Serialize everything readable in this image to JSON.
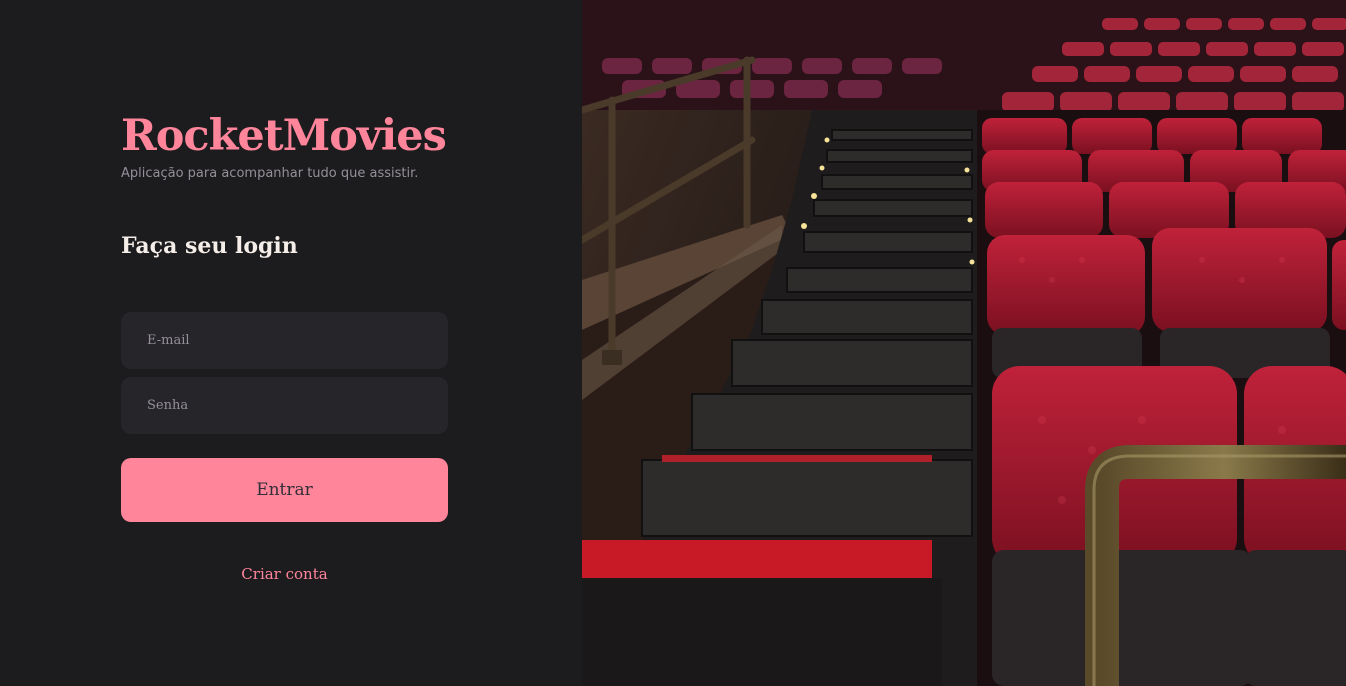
{
  "brand": {
    "title": "RocketMovies",
    "subtitle": "Aplicação para acompanhar tudo que assistir."
  },
  "form": {
    "heading": "Faça seu login",
    "email_placeholder": "E-mail",
    "password_placeholder": "Senha",
    "submit_label": "Entrar",
    "create_account_label": "Criar conta"
  },
  "colors": {
    "background": "#1c1b1e",
    "accent": "#ff859b",
    "input_background": "#262529",
    "placeholder": "#948f99",
    "heading": "#f4ede8"
  },
  "hero": {
    "image": "cinema-auditorium-photo",
    "subject": "red theater seats and stairs"
  }
}
